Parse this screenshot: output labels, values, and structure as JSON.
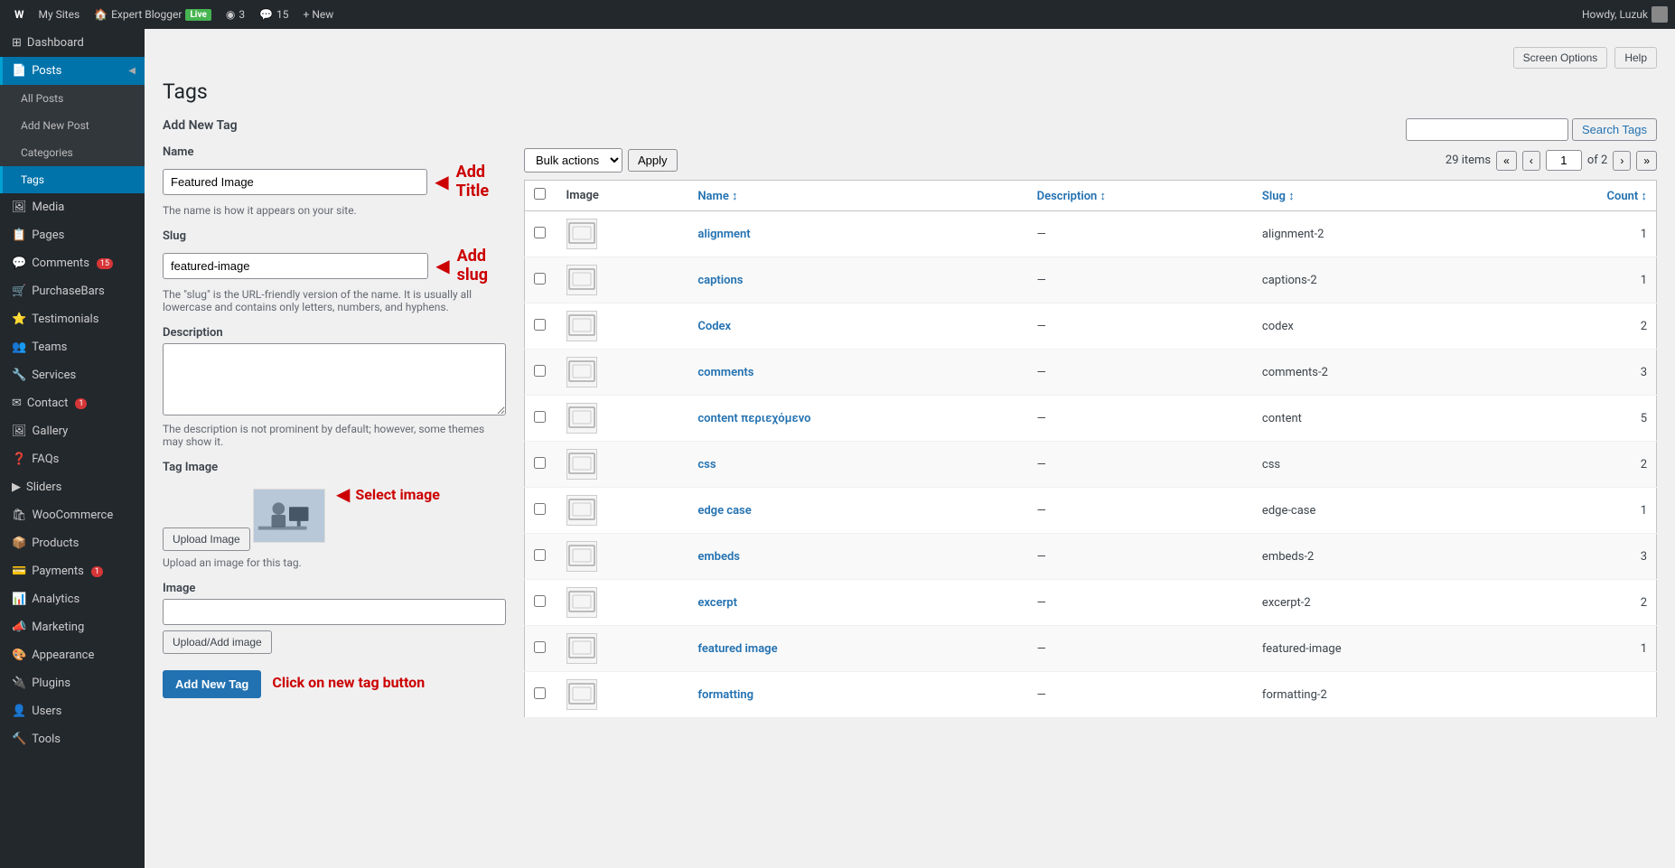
{
  "adminbar": {
    "wp_icon": "W",
    "my_sites": "My Sites",
    "site_name": "Expert Blogger",
    "live_badge": "Live",
    "revisions": "3",
    "comments": "15",
    "new": "+ New",
    "howdy": "Howdy, Luzuk",
    "screen_options": "Screen Options",
    "help": "Help"
  },
  "sidebar": {
    "items": [
      {
        "id": "dashboard",
        "label": "Dashboard",
        "icon": "⊞",
        "active": false
      },
      {
        "id": "posts",
        "label": "Posts",
        "icon": "📄",
        "active": true
      },
      {
        "id": "media",
        "label": "Media",
        "icon": "🖼",
        "active": false
      },
      {
        "id": "pages",
        "label": "Pages",
        "icon": "📋",
        "active": false
      },
      {
        "id": "comments",
        "label": "Comments",
        "icon": "💬",
        "badge": "15",
        "active": false
      },
      {
        "id": "purchase-bars",
        "label": "PurchaseBars",
        "icon": "🛒",
        "active": false
      },
      {
        "id": "testimonials",
        "label": "Testimonials",
        "icon": "⭐",
        "active": false
      },
      {
        "id": "teams",
        "label": "Teams",
        "icon": "👥",
        "active": false
      },
      {
        "id": "services",
        "label": "Services",
        "icon": "🔧",
        "active": false
      },
      {
        "id": "contact",
        "label": "Contact",
        "icon": "✉",
        "badge": "1",
        "active": false
      },
      {
        "id": "gallery",
        "label": "Gallery",
        "icon": "🖼",
        "active": false
      },
      {
        "id": "faqs",
        "label": "FAQs",
        "icon": "❓",
        "active": false
      },
      {
        "id": "sliders",
        "label": "Sliders",
        "icon": "▶",
        "active": false
      },
      {
        "id": "woocommerce",
        "label": "WooCommerce",
        "icon": "🛍",
        "active": false
      },
      {
        "id": "products",
        "label": "Products",
        "icon": "📦",
        "active": false
      },
      {
        "id": "payments",
        "label": "Payments",
        "icon": "💳",
        "badge": "1",
        "active": false
      },
      {
        "id": "analytics",
        "label": "Analytics",
        "icon": "📊",
        "active": false
      },
      {
        "id": "marketing",
        "label": "Marketing",
        "icon": "📣",
        "active": false
      },
      {
        "id": "appearance",
        "label": "Appearance",
        "icon": "🎨",
        "active": false
      },
      {
        "id": "plugins",
        "label": "Plugins",
        "icon": "🔌",
        "active": false
      },
      {
        "id": "users",
        "label": "Users",
        "icon": "👤",
        "active": false
      },
      {
        "id": "tools",
        "label": "Tools",
        "icon": "🔨",
        "active": false
      }
    ],
    "posts_submenu": [
      {
        "id": "all-posts",
        "label": "All Posts"
      },
      {
        "id": "add-new-post",
        "label": "Add New Post"
      },
      {
        "id": "categories",
        "label": "Categories"
      },
      {
        "id": "tags",
        "label": "Tags",
        "active": true
      }
    ]
  },
  "page": {
    "title": "Tags",
    "add_new_tag_title": "Add New Tag"
  },
  "form": {
    "name_label": "Name",
    "name_value": "Featured Image",
    "name_hint": "The name is how it appears on your site.",
    "slug_label": "Slug",
    "slug_value": "featured-image",
    "slug_hint": "The \"slug\" is the URL-friendly version of the name. It is usually all lowercase and contains only letters, numbers, and hyphens.",
    "description_label": "Description",
    "description_hint": "The description is not prominent by default; however, some themes may show it.",
    "tag_image_label": "Tag Image",
    "upload_image_btn": "Upload Image",
    "upload_hint": "Upload an image for this tag.",
    "image_label": "Image",
    "upload_add_image_btn": "Upload/Add image",
    "add_new_tag_btn": "Add New Tag"
  },
  "annotations": {
    "add_title": "Add Title",
    "add_slug": "Add slug",
    "select_image": "Select image",
    "click_button": "Click on new tag button"
  },
  "toolbar": {
    "bulk_actions_label": "Bulk actions",
    "apply_label": "Apply",
    "items_count": "29 items",
    "page_current": "1",
    "page_total": "2",
    "search_placeholder": "",
    "search_tags_label": "Search Tags"
  },
  "table": {
    "columns": [
      {
        "id": "image",
        "label": "Image"
      },
      {
        "id": "name",
        "label": "Name",
        "sortable": true,
        "sort_indicator": "↕"
      },
      {
        "id": "description",
        "label": "Description",
        "sortable": true,
        "sort_indicator": "↕"
      },
      {
        "id": "slug",
        "label": "Slug",
        "sortable": true,
        "sort_indicator": "↕"
      },
      {
        "id": "count",
        "label": "Count",
        "sortable": true,
        "sort_indicator": "↕"
      }
    ],
    "rows": [
      {
        "name": "alignment",
        "description": "—",
        "slug": "alignment-2",
        "count": "1"
      },
      {
        "name": "captions",
        "description": "—",
        "slug": "captions-2",
        "count": "1"
      },
      {
        "name": "Codex",
        "description": "—",
        "slug": "codex",
        "count": "2"
      },
      {
        "name": "comments",
        "description": "—",
        "slug": "comments-2",
        "count": "3"
      },
      {
        "name": "content περιεχόμενο",
        "description": "—",
        "slug": "content",
        "count": "5"
      },
      {
        "name": "css",
        "description": "—",
        "slug": "css",
        "count": "2"
      },
      {
        "name": "edge case",
        "description": "—",
        "slug": "edge-case",
        "count": "1"
      },
      {
        "name": "embeds",
        "description": "—",
        "slug": "embeds-2",
        "count": "3"
      },
      {
        "name": "excerpt",
        "description": "—",
        "slug": "excerpt-2",
        "count": "2"
      },
      {
        "name": "featured image",
        "description": "—",
        "slug": "featured-image",
        "count": "1"
      },
      {
        "name": "formatting",
        "description": "—",
        "slug": "formatting-2",
        "count": ""
      }
    ]
  }
}
